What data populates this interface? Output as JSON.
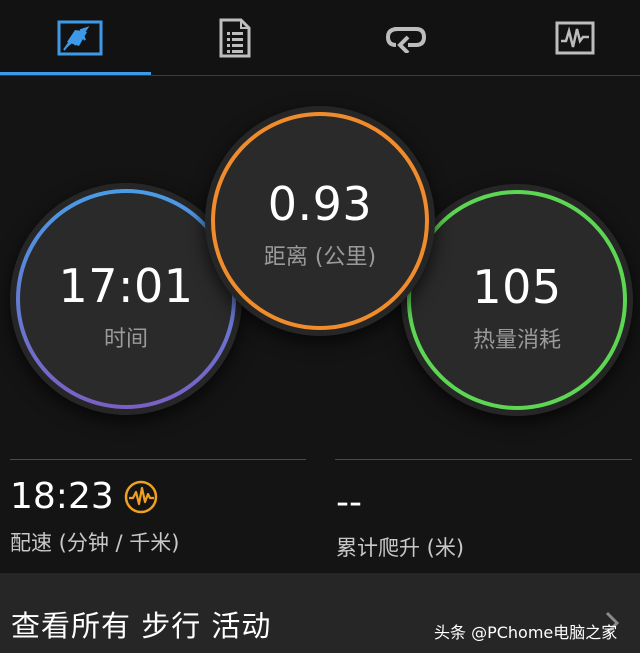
{
  "tabs": [
    {
      "name": "summary-tab",
      "icon": "map-icon",
      "active": true
    },
    {
      "name": "details-tab",
      "icon": "document-list-icon",
      "active": false
    },
    {
      "name": "laps-tab",
      "icon": "loop-arrow-icon",
      "active": false
    },
    {
      "name": "charts-tab",
      "icon": "heartbeat-chart-icon",
      "active": false
    }
  ],
  "rings": {
    "time": {
      "value": "17:01",
      "label": "时间",
      "color_top": "#4a9be6",
      "color_bottom": "#7b5fc4"
    },
    "distance": {
      "value": "0.93",
      "label": "距离 (公里)",
      "color": "#f08c2c"
    },
    "calories": {
      "value": "105",
      "label": "热量消耗",
      "color": "#5cd653"
    }
  },
  "stats": {
    "pace": {
      "value": "18:23",
      "label": "配速 (分钟 / 千米)",
      "icon": "pace-waveform-icon",
      "icon_color": "#f0a020"
    },
    "ascent": {
      "value": "--",
      "label": "累计爬升 (米)"
    }
  },
  "footer": {
    "view_all": "查看所有 步行 活动",
    "watermark": "头条 @PChome电脑之家"
  },
  "accent": "#3d9ae8"
}
